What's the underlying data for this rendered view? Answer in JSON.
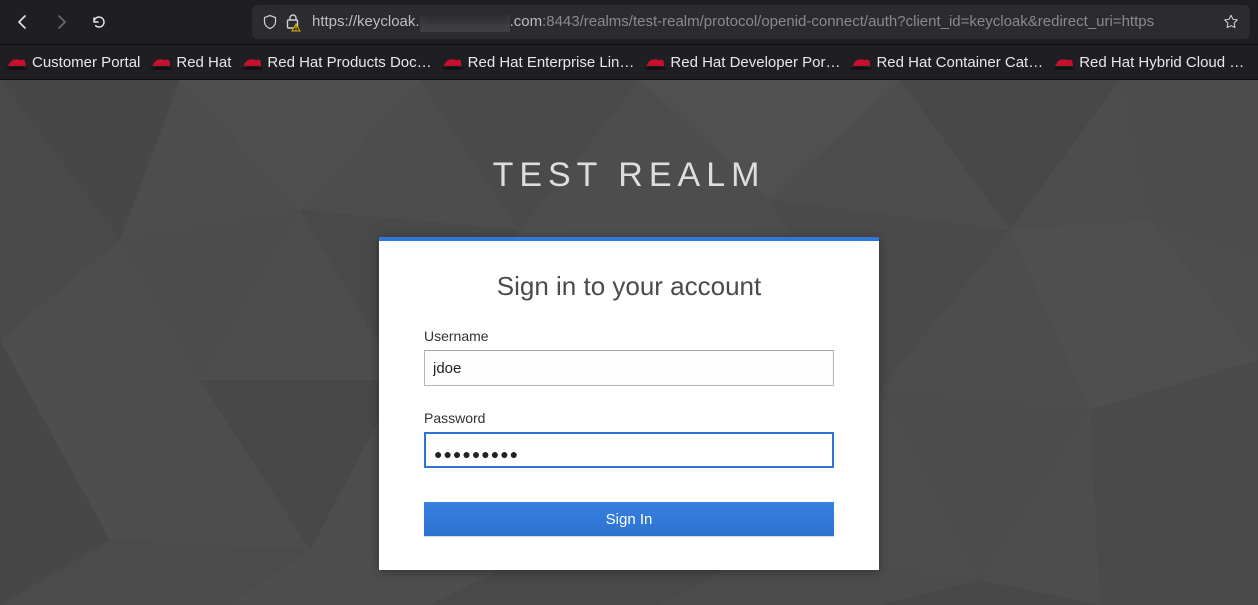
{
  "browser": {
    "url_prefix": "https://keycloak.",
    "url_domain_end": ".com",
    "url_port_path": ":8443/realms/test-realm/protocol/openid-connect/auth?client_id=keycloak&redirect_uri=https"
  },
  "bookmarks": [
    {
      "label": "Customer Portal"
    },
    {
      "label": "Red Hat"
    },
    {
      "label": "Red Hat Products Doc…"
    },
    {
      "label": "Red Hat Enterprise Lin…"
    },
    {
      "label": "Red Hat Developer Por…"
    },
    {
      "label": "Red Hat Container Cat…"
    },
    {
      "label": "Red Hat Hybrid Cloud …"
    }
  ],
  "page": {
    "realm_title": "TEST REALM",
    "card_title": "Sign in to your account",
    "username_label": "Username",
    "username_value": "jdoe",
    "password_label": "Password",
    "password_mask": "●●●●●●●●●",
    "signin_label": "Sign In"
  }
}
